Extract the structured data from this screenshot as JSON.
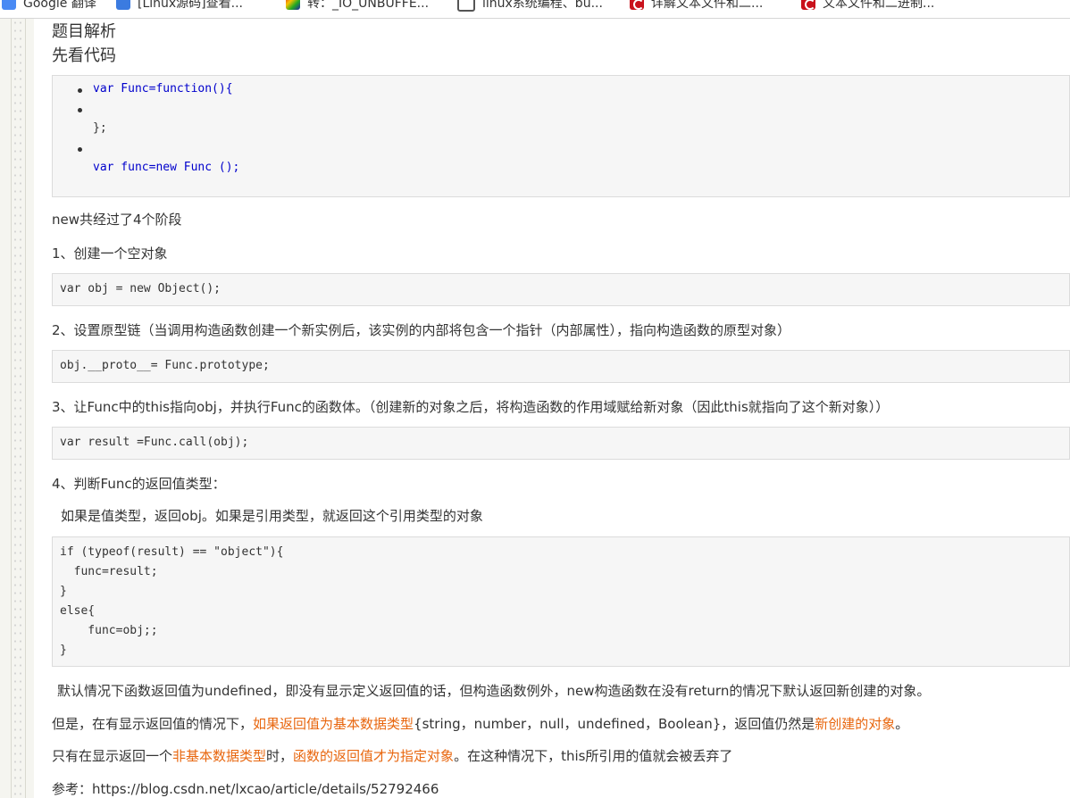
{
  "bookmarks": [
    {
      "label": "Google 翻译",
      "icon": "google-translate-icon"
    },
    {
      "label": "[Linux源码]查看...",
      "icon": "bookmark-page-icon"
    },
    {
      "label": "转：_IO_UNBUFFE...",
      "icon": "colorful-site-icon"
    },
    {
      "label": "linux系统编程、bu...",
      "icon": "search-page-icon"
    },
    {
      "label": "详解文本文件和二...",
      "icon": "csdn-icon"
    },
    {
      "label": "文本文件和二进制...",
      "icon": "csdn-icon"
    }
  ],
  "article": {
    "heading1": "题目解析",
    "heading2": "先看代码",
    "code_list": [
      "var Func=function(){",
      "",
      "};",
      "",
      "var func=new Func ();"
    ],
    "p_stages": "new共经过了4个阶段",
    "step1": "1、创建一个空对象",
    "code1": "var obj = new Object();",
    "step2": "2、设置原型链（当调用构造函数创建一个新实例后，该实例的内部将包含一个指针（内部属性），指向构造函数的原型对象）",
    "code2": "obj.__proto__= Func.prototype;",
    "step3": "3、让Func中的this指向obj，并执行Func的函数体。（创建新的对象之后，将构造函数的作用域赋给新对象（因此this就指向了这个新对象））",
    "code3": "var result =Func.call(obj);",
    "step4": "4、判断Func的返回值类型：",
    "step4_desc": "如果是值类型，返回obj。如果是引用类型，就返回这个引用类型的对象",
    "code4": [
      "if (typeof(result) == \"object\"){",
      "  func=result;",
      "}",
      "else{",
      "    func=obj;;",
      "}"
    ],
    "para_default": "默认情况下函数返回值为undefined，即没有显示定义返回值的话，但构造函数例外，new构造函数在没有return的情况下默认返回新创建的对象。",
    "para_but_1": "但是，在有显示返回值的情况下，",
    "para_but_hl1": "如果返回值为基本数据类型",
    "para_but_2": "{string，number，null，undefined，Boolean}，返回值仍然是",
    "para_but_hl2": "新创建的对象",
    "para_but_3": "。",
    "para_only_1": "只有在显示返回一个",
    "para_only_hl1": "非基本数据类型",
    "para_only_2": "时，",
    "para_only_hl2": "函数的返回值才为指定对象",
    "para_only_3": "。在这种情况下，this所引用的值就会被丢弃了",
    "reference": "参考：https://blog.csdn.net/lxcao/article/details/52792466"
  },
  "colors": {
    "highlight": "#e8660e",
    "keyword": "#0000cc",
    "code_bg": "#f6f6f6"
  }
}
